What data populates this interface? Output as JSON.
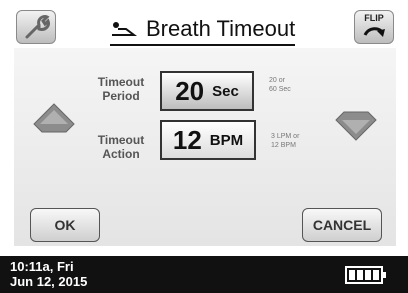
{
  "header": {
    "title": "Breath Timeout",
    "flip_label": "FLIP",
    "left_icon": "wrench-icon",
    "title_icon": "patient-icon"
  },
  "settings": {
    "timeout_period": {
      "label_line1": "Timeout",
      "label_line2": "Period",
      "value": "20",
      "unit": "Sec",
      "hint_line1": "20 or",
      "hint_line2": "60 Sec"
    },
    "timeout_action": {
      "label_line1": "Timeout",
      "label_line2": "Action",
      "value": "12",
      "unit": "BPM",
      "hint_line1": "3 LPM or",
      "hint_line2": "12 BPM"
    }
  },
  "buttons": {
    "ok": "OK",
    "cancel": "CANCEL"
  },
  "status": {
    "time_day": "10:11a, Fri",
    "date": "Jun 12, 2015",
    "battery_icon": "battery-icon"
  }
}
